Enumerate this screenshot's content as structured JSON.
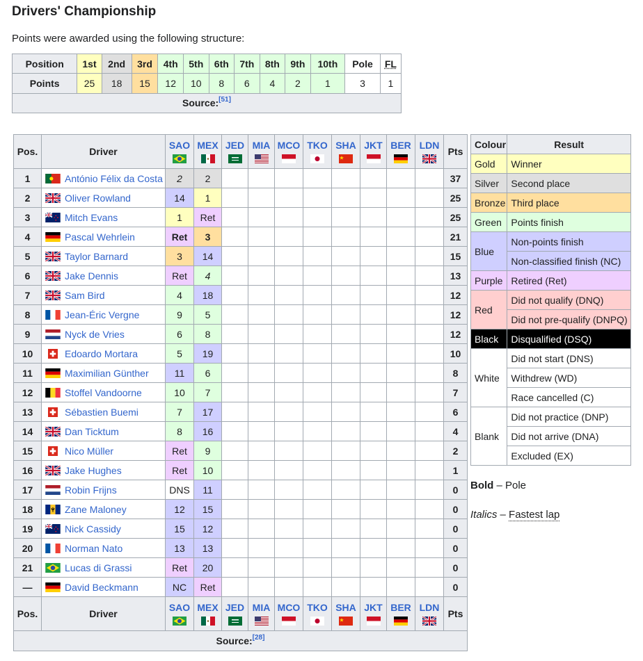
{
  "title": "Drivers' Championship",
  "intro": "Points were awarded using the following structure:",
  "points_table": {
    "row1_label": "Position",
    "row2_label": "Points",
    "columns": [
      {
        "pos": "1st",
        "pts": "25",
        "color": "#ffffbf"
      },
      {
        "pos": "2nd",
        "pts": "18",
        "color": "#dfdfdf"
      },
      {
        "pos": "3rd",
        "pts": "15",
        "color": "#ffdf9f"
      },
      {
        "pos": "4th",
        "pts": "12",
        "color": "#dfffdf"
      },
      {
        "pos": "5th",
        "pts": "10",
        "color": "#dfffdf"
      },
      {
        "pos": "6th",
        "pts": "8",
        "color": "#dfffdf"
      },
      {
        "pos": "7th",
        "pts": "6",
        "color": "#dfffdf"
      },
      {
        "pos": "8th",
        "pts": "4",
        "color": "#dfffdf"
      },
      {
        "pos": "9th",
        "pts": "2",
        "color": "#dfffdf"
      },
      {
        "pos": "10th",
        "pts": "1",
        "color": "#dfffdf"
      },
      {
        "pos": "Pole",
        "pts": "3",
        "color": "#ffffff"
      },
      {
        "pos": "FL",
        "pts": "1",
        "color": "#ffffff"
      }
    ],
    "source_label": "Source:",
    "source_ref": "[51]"
  },
  "results": {
    "pos_header": "Pos.",
    "driver_header": "Driver",
    "pts_header": "Pts",
    "races": [
      {
        "code": "SAO",
        "flag": "brazil-flag"
      },
      {
        "code": "MEX",
        "flag": "mexico-flag"
      },
      {
        "code": "JED",
        "flag": "saudi-arabia-flag"
      },
      {
        "code": "MIA",
        "flag": "usa-flag"
      },
      {
        "code": "MCO",
        "flag": "monaco-flag"
      },
      {
        "code": "TKO",
        "flag": "japan-flag"
      },
      {
        "code": "SHA",
        "flag": "china-flag"
      },
      {
        "code": "JKT",
        "flag": "indonesia-flag"
      },
      {
        "code": "BER",
        "flag": "germany-flag"
      },
      {
        "code": "LDN",
        "flag": "uk-flag"
      }
    ],
    "rows": [
      {
        "pos": "1",
        "driver": "António Félix da Costa",
        "flag": "portugal-flag",
        "r1": "2",
        "r1c": "silver",
        "r1s": "i",
        "r2": "2",
        "r2c": "silver",
        "r2s": "",
        "pts": "37"
      },
      {
        "pos": "2",
        "driver": "Oliver Rowland",
        "flag": "uk-flag",
        "r1": "14",
        "r1c": "blue",
        "r1s": "",
        "r2": "1",
        "r2c": "gold",
        "r2s": "",
        "pts": "25"
      },
      {
        "pos": "3",
        "driver": "Mitch Evans",
        "flag": "new-zealand-flag",
        "r1": "1",
        "r1c": "gold",
        "r1s": "",
        "r2": "Ret",
        "r2c": "purple",
        "r2s": "",
        "pts": "25"
      },
      {
        "pos": "4",
        "driver": "Pascal Wehrlein",
        "flag": "germany-flag",
        "r1": "Ret",
        "r1c": "purple",
        "r1s": "b",
        "r2": "3",
        "r2c": "bronze",
        "r2s": "b",
        "pts": "21"
      },
      {
        "pos": "5",
        "driver": "Taylor Barnard",
        "flag": "uk-flag",
        "r1": "3",
        "r1c": "bronze",
        "r1s": "",
        "r2": "14",
        "r2c": "blue",
        "r2s": "",
        "pts": "15"
      },
      {
        "pos": "6",
        "driver": "Jake Dennis",
        "flag": "uk-flag",
        "r1": "Ret",
        "r1c": "purple",
        "r1s": "",
        "r2": "4",
        "r2c": "green",
        "r2s": "i",
        "pts": "13"
      },
      {
        "pos": "7",
        "driver": "Sam Bird",
        "flag": "uk-flag",
        "r1": "4",
        "r1c": "green",
        "r1s": "",
        "r2": "18",
        "r2c": "blue",
        "r2s": "",
        "pts": "12"
      },
      {
        "pos": "8",
        "driver": "Jean-Éric Vergne",
        "flag": "france-flag",
        "r1": "9",
        "r1c": "green",
        "r1s": "",
        "r2": "5",
        "r2c": "green",
        "r2s": "",
        "pts": "12"
      },
      {
        "pos": "9",
        "driver": "Nyck de Vries",
        "flag": "netherlands-flag",
        "r1": "6",
        "r1c": "green",
        "r1s": "",
        "r2": "8",
        "r2c": "green",
        "r2s": "",
        "pts": "12"
      },
      {
        "pos": "10",
        "driver": "Edoardo Mortara",
        "flag": "switzerland-flag",
        "r1": "5",
        "r1c": "green",
        "r1s": "",
        "r2": "19",
        "r2c": "blue",
        "r2s": "",
        "pts": "10"
      },
      {
        "pos": "11",
        "driver": "Maximilian Günther",
        "flag": "germany-flag",
        "r1": "11",
        "r1c": "blue",
        "r1s": "",
        "r2": "6",
        "r2c": "green",
        "r2s": "",
        "pts": "8"
      },
      {
        "pos": "12",
        "driver": "Stoffel Vandoorne",
        "flag": "belgium-flag",
        "r1": "10",
        "r1c": "green",
        "r1s": "",
        "r2": "7",
        "r2c": "green",
        "r2s": "",
        "pts": "7"
      },
      {
        "pos": "13",
        "driver": "Sébastien Buemi",
        "flag": "switzerland-flag",
        "r1": "7",
        "r1c": "green",
        "r1s": "",
        "r2": "17",
        "r2c": "blue",
        "r2s": "",
        "pts": "6"
      },
      {
        "pos": "14",
        "driver": "Dan Ticktum",
        "flag": "uk-flag",
        "r1": "8",
        "r1c": "green",
        "r1s": "",
        "r2": "16",
        "r2c": "blue",
        "r2s": "",
        "pts": "4"
      },
      {
        "pos": "15",
        "driver": "Nico Müller",
        "flag": "switzerland-flag",
        "r1": "Ret",
        "r1c": "purple",
        "r1s": "",
        "r2": "9",
        "r2c": "green",
        "r2s": "",
        "pts": "2"
      },
      {
        "pos": "16",
        "driver": "Jake Hughes",
        "flag": "uk-flag",
        "r1": "Ret",
        "r1c": "purple",
        "r1s": "",
        "r2": "10",
        "r2c": "green",
        "r2s": "",
        "pts": "1"
      },
      {
        "pos": "17",
        "driver": "Robin Frijns",
        "flag": "netherlands-flag",
        "r1": "DNS",
        "r1c": "white",
        "r1s": "",
        "r2": "11",
        "r2c": "blue",
        "r2s": "",
        "pts": "0"
      },
      {
        "pos": "18",
        "driver": "Zane Maloney",
        "flag": "barbados-flag",
        "r1": "12",
        "r1c": "blue",
        "r1s": "",
        "r2": "15",
        "r2c": "blue",
        "r2s": "",
        "pts": "0"
      },
      {
        "pos": "19",
        "driver": "Nick Cassidy",
        "flag": "new-zealand-flag",
        "r1": "15",
        "r1c": "blue",
        "r1s": "",
        "r2": "12",
        "r2c": "blue",
        "r2s": "",
        "pts": "0"
      },
      {
        "pos": "20",
        "driver": "Norman Nato",
        "flag": "france-flag",
        "r1": "13",
        "r1c": "blue",
        "r1s": "",
        "r2": "13",
        "r2c": "blue",
        "r2s": "",
        "pts": "0"
      },
      {
        "pos": "21",
        "driver": "Lucas di Grassi",
        "flag": "brazil-flag",
        "r1": "Ret",
        "r1c": "purple",
        "r1s": "",
        "r2": "20",
        "r2c": "blue",
        "r2s": "",
        "pts": "0"
      },
      {
        "pos": "—",
        "driver": "David Beckmann",
        "flag": "germany-flag",
        "r1": "NC",
        "r1c": "blue",
        "r1s": "",
        "r2": "Ret",
        "r2c": "purple",
        "r2s": "",
        "pts": "0"
      }
    ],
    "source_label": "Source:",
    "source_ref": "[28]"
  },
  "key": {
    "colour_header": "Colour",
    "result_header": "Result",
    "groups": [
      {
        "colour": "Gold",
        "cls": "gold",
        "results": [
          "Winner"
        ]
      },
      {
        "colour": "Silver",
        "cls": "silver",
        "results": [
          "Second place"
        ]
      },
      {
        "colour": "Bronze",
        "cls": "bronze",
        "results": [
          "Third place"
        ]
      },
      {
        "colour": "Green",
        "cls": "green",
        "results": [
          "Points finish"
        ]
      },
      {
        "colour": "Blue",
        "cls": "blue",
        "results": [
          "Non-points finish",
          "Non-classified finish (NC)"
        ]
      },
      {
        "colour": "Purple",
        "cls": "purple",
        "results": [
          "Retired (Ret)"
        ]
      },
      {
        "colour": "Red",
        "cls": "red",
        "results": [
          "Did not qualify (DNQ)",
          "Did not pre-qualify (DNPQ)"
        ]
      },
      {
        "colour": "Black",
        "cls": "black",
        "results": [
          "Disqualified (DSQ)"
        ]
      },
      {
        "colour": "White",
        "cls": "white",
        "results": [
          "Did not start (DNS)",
          "Withdrew (WD)",
          "Race cancelled (C)"
        ]
      },
      {
        "colour": "Blank",
        "cls": "white",
        "results": [
          "Did not practice (DNP)",
          "Did not arrive (DNA)",
          "Excluded (EX)"
        ]
      }
    ],
    "bold_label": "Bold",
    "bold_desc": " – Pole",
    "italic_label": "Italics",
    "italic_sep": " – ",
    "italic_desc": "Fastest lap"
  }
}
